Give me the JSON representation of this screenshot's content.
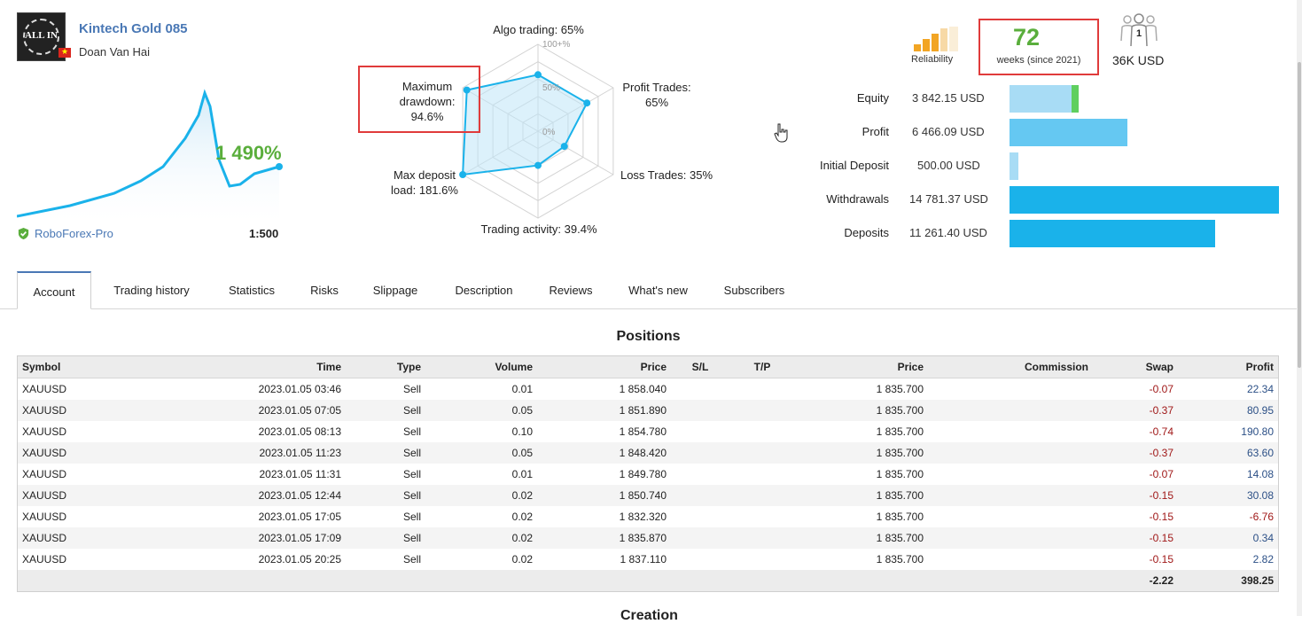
{
  "signal": {
    "name": "Kintech Gold 085",
    "author": "Doan Van Hai",
    "avatar_text": "ALL IN",
    "growth": "1 490%",
    "broker": "RoboForex-Pro",
    "leverage": "1:500"
  },
  "radar": {
    "algo_trading": "Algo trading: 65%",
    "profit_trades": [
      "Profit Trades:",
      "65%"
    ],
    "loss_trades": "Loss Trades: 35%",
    "trading_activity": "Trading activity: 39.4%",
    "max_deposit_load": [
      "Max deposit",
      "load: 181.6%"
    ],
    "max_drawdown": [
      "Maximum",
      "drawdown:",
      "94.6%"
    ],
    "ticks": [
      "100+%",
      "50%",
      "0%"
    ],
    "values": {
      "algo_trading": 0.65,
      "profit_trades": 0.65,
      "loss_trades": 0.35,
      "trading_activity": 0.394,
      "max_deposit_load": 1.0,
      "max_drawdown": 0.946
    }
  },
  "reliability": {
    "label": "Reliability",
    "weeks": "72",
    "weeks_label": "weeks (since 2021)",
    "subscribers_count": "1",
    "subscribers_amount": "36K USD"
  },
  "financials": [
    {
      "label": "Equity",
      "value": "3 842.15 USD",
      "bar_fraction": 0.049,
      "color": "#a8dcf5",
      "extra": "#5fcf5f"
    },
    {
      "label": "Profit",
      "value": "6 466.09 USD",
      "bar_fraction": 0.437,
      "color": "#65c8f2"
    },
    {
      "label": "Initial Deposit",
      "value": "500.00 USD",
      "bar_fraction": 0.034,
      "color": "#a8dcf5"
    },
    {
      "label": "Withdrawals",
      "value": "14 781.37 USD",
      "bar_fraction": 1.0,
      "color": "#1ab2ea"
    },
    {
      "label": "Deposits",
      "value": "11 261.40 USD",
      "bar_fraction": 0.762,
      "color": "#1ab2ea"
    }
  ],
  "tabs": [
    "Account",
    "Trading history",
    "Statistics",
    "Risks",
    "Slippage",
    "Description",
    "Reviews",
    "What's new",
    "Subscribers"
  ],
  "positions": {
    "title": "Positions",
    "headers": [
      "Symbol",
      "Time",
      "Type",
      "Volume",
      "Price",
      "S/L",
      "T/P",
      "Price",
      "Commission",
      "Swap",
      "Profit"
    ],
    "rows": [
      [
        "XAUUSD",
        "2023.01.05 03:46",
        "Sell",
        "0.01",
        "1 858.040",
        "",
        "",
        "1 835.700",
        "",
        "-0.07",
        "22.34"
      ],
      [
        "XAUUSD",
        "2023.01.05 07:05",
        "Sell",
        "0.05",
        "1 851.890",
        "",
        "",
        "1 835.700",
        "",
        "-0.37",
        "80.95"
      ],
      [
        "XAUUSD",
        "2023.01.05 08:13",
        "Sell",
        "0.10",
        "1 854.780",
        "",
        "",
        "1 835.700",
        "",
        "-0.74",
        "190.80"
      ],
      [
        "XAUUSD",
        "2023.01.05 11:23",
        "Sell",
        "0.05",
        "1 848.420",
        "",
        "",
        "1 835.700",
        "",
        "-0.37",
        "63.60"
      ],
      [
        "XAUUSD",
        "2023.01.05 11:31",
        "Sell",
        "0.01",
        "1 849.780",
        "",
        "",
        "1 835.700",
        "",
        "-0.07",
        "14.08"
      ],
      [
        "XAUUSD",
        "2023.01.05 12:44",
        "Sell",
        "0.02",
        "1 850.740",
        "",
        "",
        "1 835.700",
        "",
        "-0.15",
        "30.08"
      ],
      [
        "XAUUSD",
        "2023.01.05 17:05",
        "Sell",
        "0.02",
        "1 832.320",
        "",
        "",
        "1 835.700",
        "",
        "-0.15",
        "-6.76"
      ],
      [
        "XAUUSD",
        "2023.01.05 17:09",
        "Sell",
        "0.02",
        "1 835.870",
        "",
        "",
        "1 835.700",
        "",
        "-0.15",
        "0.34"
      ],
      [
        "XAUUSD",
        "2023.01.05 20:25",
        "Sell",
        "0.02",
        "1 837.110",
        "",
        "",
        "1 835.700",
        "",
        "-0.15",
        "2.82"
      ]
    ],
    "totals": {
      "swap": "-2.22",
      "profit": "398.25"
    }
  },
  "next_section_title": "Creation",
  "colors": {
    "accent": "#4a78b5",
    "green": "#5aae3c",
    "highlight": "#e03b3b",
    "negative": "#a01818"
  }
}
